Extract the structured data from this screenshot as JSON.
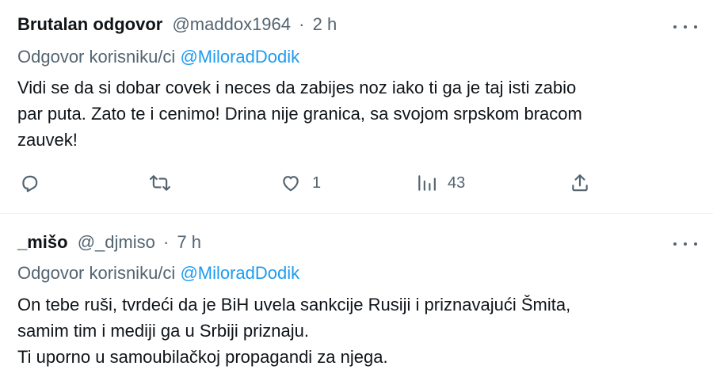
{
  "tweets": [
    {
      "name": "Brutalan odgovor",
      "handle": "@maddox1964",
      "dot": "·",
      "time": "2 h",
      "reply_prefix": "Odgovor korisniku/ci",
      "reply_to": "@MiloradDodik",
      "lines": [
        "Vidi se da si dobar covek i neces da zabijes noz iako ti ga je taj isti zabio",
        "par puta. Zato te i cenimo! Drina nije granica, sa svojom srpskom bracom",
        "zauvek!"
      ],
      "actions": {
        "reply_count": "",
        "retweet_count": "",
        "like_count": "1",
        "views_count": "43"
      }
    },
    {
      "name": "_mišo",
      "handle": "@_djmiso",
      "dot": "·",
      "time": "7 h",
      "reply_prefix": "Odgovor korisniku/ci",
      "reply_to": "@MiloradDodik",
      "lines": [
        "On tebe ruši, tvrdeći da je BiH uvela sankcije Rusiji i priznavajući Šmita,",
        "samim tim i mediji ga u Srbiji priznaju.",
        "Ti uporno u samoubilačkoj propagandi za njega."
      ]
    }
  ],
  "icons": [
    "more-icon",
    "reply-icon",
    "retweet-icon",
    "like-icon",
    "views-icon",
    "share-icon"
  ],
  "colors": {
    "text": "#0f1419",
    "muted": "#536471",
    "link": "#1d9bf0",
    "divider": "#eff3f4"
  }
}
